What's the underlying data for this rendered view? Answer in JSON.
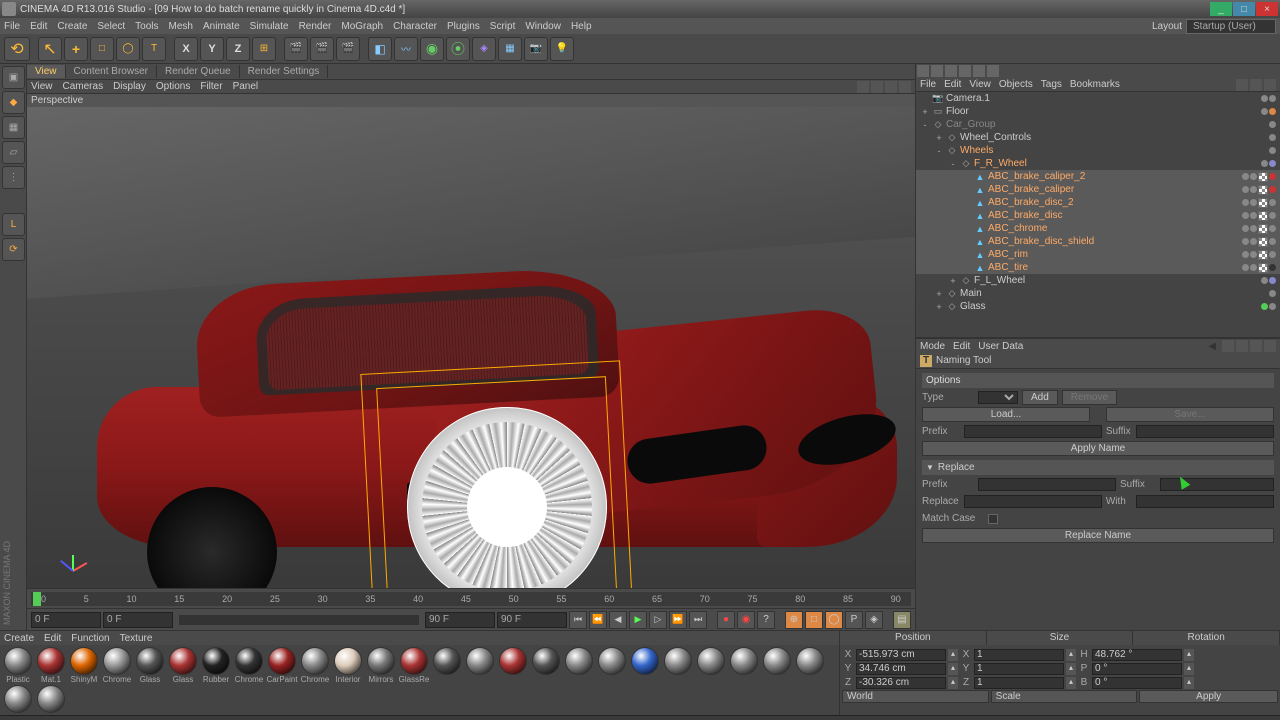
{
  "title": "CINEMA 4D R13.016 Studio - [09 How to do batch rename quickly in Cinema 4D.c4d *]",
  "menubar": [
    "File",
    "Edit",
    "Create",
    "Select",
    "Tools",
    "Mesh",
    "Animate",
    "Simulate",
    "Render",
    "MoGraph",
    "Character",
    "Plugins",
    "Script",
    "Window",
    "Help"
  ],
  "layout_label": "Layout",
  "layout_value": "Startup (User)",
  "viewport": {
    "tabs": [
      "View",
      "Content Browser",
      "Render Queue",
      "Render Settings"
    ],
    "menus": [
      "View",
      "Cameras",
      "Display",
      "Options",
      "Filter",
      "Panel"
    ],
    "label": "Perspective"
  },
  "objects": {
    "menus": [
      "File",
      "Edit",
      "View",
      "Objects",
      "Tags",
      "Bookmarks"
    ],
    "tree": [
      {
        "depth": 0,
        "tw": "",
        "icon": "cam",
        "name": "Camera.1",
        "cls": "",
        "tags": [
          "gd",
          "gd"
        ]
      },
      {
        "depth": 0,
        "tw": "+",
        "icon": "plane",
        "name": "Floor",
        "cls": "",
        "tags": [
          "gd",
          "or"
        ]
      },
      {
        "depth": 0,
        "tw": "-",
        "icon": "null",
        "name": "Car_Group",
        "cls": "gray",
        "tags": [
          "gd"
        ]
      },
      {
        "depth": 1,
        "tw": "+",
        "icon": "null",
        "name": "Wheel_Controls",
        "cls": "",
        "tags": [
          "gd"
        ]
      },
      {
        "depth": 1,
        "tw": "-",
        "icon": "null",
        "name": "Wheels",
        "cls": "orange",
        "tags": [
          "gd"
        ]
      },
      {
        "depth": 2,
        "tw": "-",
        "icon": "null",
        "name": "F_R_Wheel",
        "cls": "orange",
        "tags": [
          "gd",
          "sp"
        ]
      },
      {
        "depth": 3,
        "tw": "",
        "icon": "poly",
        "name": "ABC_brake_caliper_2",
        "cls": "orange",
        "tags": [
          "gd",
          "gd",
          "chk",
          "rd"
        ]
      },
      {
        "depth": 3,
        "tw": "",
        "icon": "poly",
        "name": "ABC_brake_caliper",
        "cls": "orange",
        "tags": [
          "gd",
          "gd",
          "chk",
          "rd"
        ]
      },
      {
        "depth": 3,
        "tw": "",
        "icon": "poly",
        "name": "ABC_brake_disc_2",
        "cls": "orange",
        "tags": [
          "gd",
          "gd",
          "chk",
          "gr"
        ]
      },
      {
        "depth": 3,
        "tw": "",
        "icon": "poly",
        "name": "ABC_brake_disc",
        "cls": "orange",
        "tags": [
          "gd",
          "gd",
          "chk",
          "gr"
        ]
      },
      {
        "depth": 3,
        "tw": "",
        "icon": "poly",
        "name": "ABC_chrome",
        "cls": "orange",
        "tags": [
          "gd",
          "gd",
          "chk",
          "gr"
        ]
      },
      {
        "depth": 3,
        "tw": "",
        "icon": "poly",
        "name": "ABC_brake_disc_shield",
        "cls": "orange",
        "tags": [
          "gd",
          "gd",
          "chk",
          "gr"
        ]
      },
      {
        "depth": 3,
        "tw": "",
        "icon": "poly",
        "name": "ABC_rim",
        "cls": "orange",
        "tags": [
          "gd",
          "gd",
          "chk",
          "gr"
        ]
      },
      {
        "depth": 3,
        "tw": "",
        "icon": "poly",
        "name": "ABC_tire",
        "cls": "orange",
        "tags": [
          "gd",
          "gd",
          "chk",
          "dk"
        ]
      },
      {
        "depth": 2,
        "tw": "+",
        "icon": "null",
        "name": "F_L_Wheel",
        "cls": "",
        "tags": [
          "gd",
          "sp"
        ]
      },
      {
        "depth": 1,
        "tw": "+",
        "icon": "null",
        "name": "Main",
        "cls": "",
        "tags": [
          "gd"
        ]
      },
      {
        "depth": 1,
        "tw": "+",
        "icon": "null",
        "name": "Glass",
        "cls": "",
        "tags": [
          "gn",
          "gd"
        ]
      }
    ]
  },
  "attr": {
    "menus": [
      "Mode",
      "Edit",
      "User Data"
    ],
    "title": "Naming Tool",
    "options_hdr": "Options",
    "type_label": "Type",
    "add_btn": "Add",
    "remove_btn": "Remove",
    "load_btn": "Load...",
    "save_btn": "Save...",
    "prefix_label": "Prefix",
    "suffix_label": "Suffix",
    "apply_name_btn": "Apply Name",
    "replace_hdr": "Replace",
    "r_prefix": "Prefix",
    "r_suffix": "Suffix",
    "r_replace": "Replace",
    "r_with": "With",
    "match_case": "Match Case",
    "replace_name_btn": "Replace Name"
  },
  "timeline": {
    "ticks": [
      "0",
      "5",
      "10",
      "15",
      "20",
      "25",
      "30",
      "35",
      "40",
      "45",
      "50",
      "55",
      "60",
      "65",
      "70",
      "75",
      "80",
      "85",
      "90"
    ],
    "start": "0 F",
    "current": "0 F",
    "end": "90 F",
    "end2": "90 F"
  },
  "materials": {
    "menus": [
      "Create",
      "Edit",
      "Function",
      "Texture"
    ],
    "items": [
      "Plastic",
      "Mat.1",
      "ShinyM",
      "Chrome",
      "Glass",
      "Glass",
      "Rubber",
      "Chrome",
      "CarPaint",
      "Chrome",
      "Interior",
      "Mirrors",
      "GlassRe",
      "",
      "",
      "",
      "",
      "",
      "",
      "",
      "",
      "",
      "",
      "",
      "",
      "",
      ""
    ]
  },
  "coords": {
    "headers": [
      "Position",
      "Size",
      "Rotation"
    ],
    "rows": [
      {
        "axis": "X",
        "pos": "-515.973 cm",
        "size": "1",
        "rot": "48.762 °"
      },
      {
        "axis": "Y",
        "pos": "34.746 cm",
        "size": "1",
        "rot": "0 °"
      },
      {
        "axis": "Z",
        "pos": "-30.326 cm",
        "size": "1",
        "rot": "0 °"
      }
    ],
    "world": "World",
    "scale": "Scale",
    "apply": "Apply"
  },
  "side_brand": "MAXON CINEMA 4D"
}
